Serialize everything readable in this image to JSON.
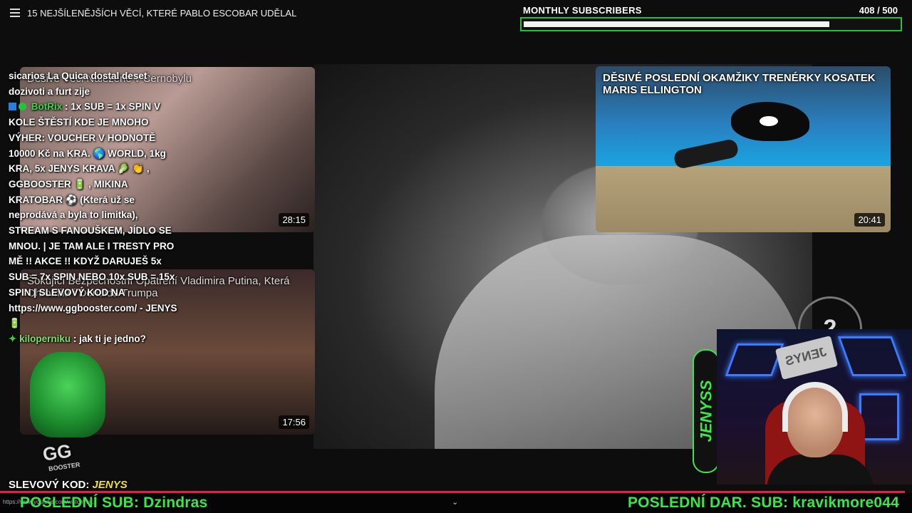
{
  "top_bar": {
    "title": "15 NEJŠÍLENĚJŠÍCH VĚCÍ, KTERÉ PABLO ESCOBAR UDĚLAL"
  },
  "subscribers": {
    "label": "MONTHLY SUBSCRIBERS",
    "count": "408",
    "goal": "/ 500",
    "progress": 0.816
  },
  "cards": [
    {
      "title": "Děsivé Věci Nalezené v Černobylu",
      "duration": "28:15"
    },
    {
      "title": "Šokující Bezpečnostní Opatření Vladimira Putina, Která Ohromila i Donalda Trumpa",
      "duration": "17:56"
    },
    {
      "title": "DĚSIVÉ POSLEDNÍ OKAMŽIKY TRENÉRKY KOSATEK MARIS ELLINGTON",
      "duration": "20:41"
    }
  ],
  "chat": {
    "msg1": "sicarios La Quica dostal deset dozivoti a furt zije",
    "bot_user": "BotRix",
    "bot_msg": " : 1x SUB = 1x SPIN V KOLE ŠTĚSTÍ KDE JE MNOHO VÝHER: VOUCHER V HODNOTĚ 10000 Kč na KRA. 🌎 WORLD, 1kg KRA, 5x JENYS KRAVA 🥬 👏 , GGBOOSTER 🔋 , MIKINA KRATOBAR ⚽ (Která už se neprodává a byla to limitka), STREAM S FANOUŠKEM, JÍDLO SE MNOU. | JE TAM ALE I TRESTY PRO MĚ !! AKCE !! KDYŽ DARUJEŠ 5x SUB = 7x SPIN NEBO 10x SUB = 15x SPIN | SLEVOVÝ KOD NA https://www.ggbooster.com/ - JENYS 🔋",
    "kilo_user": "kiloperniku",
    "kilo_msg": " : jak ti je jedno?"
  },
  "ggbooster": {
    "text": "GG",
    "sub": "BOOSTER"
  },
  "discount": {
    "label": "SLEVOVÝ KOD:",
    "value": "JENYS"
  },
  "bottom": {
    "last_sub": "POSLEDNÍ SUB: Dzindras",
    "last_donation": "POSLEDNÍ DAR. SUB: kravikmore044",
    "url": "https://www.youtube.com/watch?v=...",
    "chevron": "⌄"
  },
  "streamer_logo": "JENYSS",
  "webcam_sign": "JENYS",
  "bg_number": "2",
  "colors": {
    "accent_green": "#3be64a",
    "progress_border": "#21c23d",
    "red_line": "#e0204a",
    "code_yellow": "#f4e02a"
  },
  "icons": [
    "menu-icon",
    "chevron-down-icon"
  ]
}
